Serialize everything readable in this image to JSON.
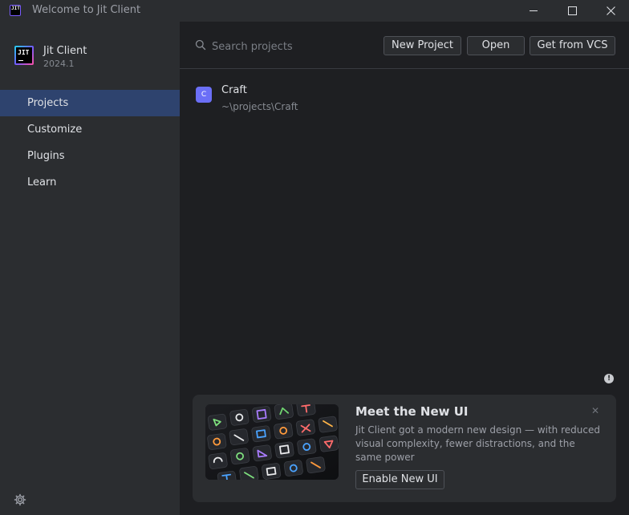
{
  "window": {
    "title": "Welcome to Jit Client",
    "app_icon_text": "JIT"
  },
  "sidebar": {
    "app_name": "Jit Client",
    "version": "2024.1",
    "items": [
      {
        "label": "Projects",
        "active": true
      },
      {
        "label": "Customize",
        "active": false
      },
      {
        "label": "Plugins",
        "active": false
      },
      {
        "label": "Learn",
        "active": false
      }
    ]
  },
  "toolbar": {
    "search_placeholder": "Search projects",
    "new_project_label": "New Project",
    "open_label": "Open",
    "vcs_label": "Get from VCS"
  },
  "projects": [
    {
      "icon_letter": "C",
      "name": "Craft",
      "path": "~\\projects\\Craft",
      "icon_color": "#6b6ff7"
    }
  ],
  "banner": {
    "title": "Meet the New UI",
    "text": "Jit Client got a modern new design — with reduced visual complexity, fewer distractions, and the same power",
    "button_label": "Enable New UI",
    "close_icon": "close-icon"
  },
  "colors": {
    "sidebar_bg": "#2b2d30",
    "main_bg": "#1e1f22",
    "active_item": "#2e436e",
    "accent": "#6b6ff7"
  }
}
